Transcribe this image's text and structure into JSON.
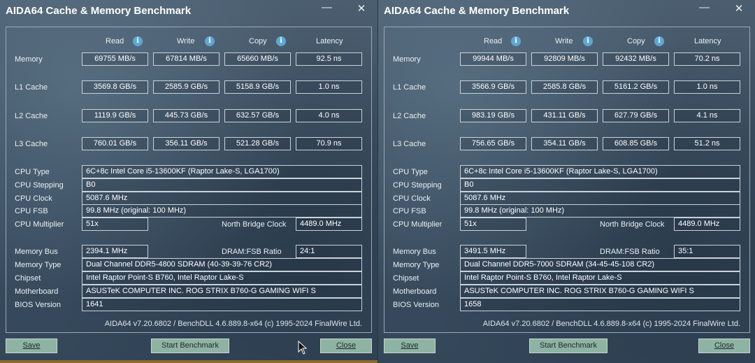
{
  "windows": [
    {
      "title": "AIDA64 Cache & Memory Benchmark",
      "headers": {
        "read": "Read",
        "write": "Write",
        "copy": "Copy",
        "latency": "Latency"
      },
      "rows": [
        {
          "label": "Memory",
          "read": "69755 MB/s",
          "write": "67814 MB/s",
          "copy": "65660 MB/s",
          "latency": "92.5 ns"
        },
        {
          "label": "L1 Cache",
          "read": "3569.8 GB/s",
          "write": "2585.9 GB/s",
          "copy": "5158.9 GB/s",
          "latency": "1.0 ns"
        },
        {
          "label": "L2 Cache",
          "read": "1119.9 GB/s",
          "write": "445.73 GB/s",
          "copy": "632.57 GB/s",
          "latency": "4.0 ns"
        },
        {
          "label": "L3 Cache",
          "read": "760.01 GB/s",
          "write": "356.11 GB/s",
          "copy": "521.28 GB/s",
          "latency": "70.9 ns"
        }
      ],
      "info": {
        "cpu_type_label": "CPU Type",
        "cpu_type": "6C+8c Intel Core i5-13600KF  (Raptor Lake-S, LGA1700)",
        "cpu_stepping_label": "CPU Stepping",
        "cpu_stepping": "B0",
        "cpu_clock_label": "CPU Clock",
        "cpu_clock": "5087.6 MHz",
        "cpu_fsb_label": "CPU FSB",
        "cpu_fsb": "99.8 MHz  (original: 100 MHz)",
        "cpu_multiplier_label": "CPU Multiplier",
        "cpu_multiplier": "51x",
        "north_bridge_label": "North Bridge Clock",
        "north_bridge": "4489.0 MHz",
        "memory_bus_label": "Memory Bus",
        "memory_bus": "2394.1 MHz",
        "dram_fsb_label": "DRAM:FSB Ratio",
        "dram_fsb": "24:1",
        "memory_type_label": "Memory Type",
        "memory_type": "Dual Channel DDR5-4800 SDRAM  (40-39-39-76 CR2)",
        "chipset_label": "Chipset",
        "chipset": "Intel Raptor Point-S B760, Intel Raptor Lake-S",
        "motherboard_label": "Motherboard",
        "motherboard": "ASUSTeK COMPUTER INC. ROG STRIX B760-G GAMING WIFI S",
        "bios_label": "BIOS Version",
        "bios": "1641"
      },
      "footer": "AIDA64 v7.20.6802 / BenchDLL 4.6.889.8-x64  (c) 1995-2024 FinalWire Ltd.",
      "buttons": {
        "save": "Save",
        "start": "Start Benchmark",
        "close": "Close"
      }
    },
    {
      "title": "AIDA64 Cache & Memory Benchmark",
      "headers": {
        "read": "Read",
        "write": "Write",
        "copy": "Copy",
        "latency": "Latency"
      },
      "rows": [
        {
          "label": "Memory",
          "read": "99944 MB/s",
          "write": "92809 MB/s",
          "copy": "92432 MB/s",
          "latency": "70.2 ns"
        },
        {
          "label": "L1 Cache",
          "read": "3566.9 GB/s",
          "write": "2585.8 GB/s",
          "copy": "5161.2 GB/s",
          "latency": "1.0 ns"
        },
        {
          "label": "L2 Cache",
          "read": "983.19 GB/s",
          "write": "431.11 GB/s",
          "copy": "627.79 GB/s",
          "latency": "4.1 ns"
        },
        {
          "label": "L3 Cache",
          "read": "756.65 GB/s",
          "write": "354.11 GB/s",
          "copy": "608.85 GB/s",
          "latency": "51.2 ns"
        }
      ],
      "info": {
        "cpu_type_label": "CPU Type",
        "cpu_type": "6C+8c Intel Core i5-13600KF  (Raptor Lake-S, LGA1700)",
        "cpu_stepping_label": "CPU Stepping",
        "cpu_stepping": "B0",
        "cpu_clock_label": "CPU Clock",
        "cpu_clock": "5087.6 MHz",
        "cpu_fsb_label": "CPU FSB",
        "cpu_fsb": "99.8 MHz  (original: 100 MHz)",
        "cpu_multiplier_label": "CPU Multiplier",
        "cpu_multiplier": "51x",
        "north_bridge_label": "North Bridge Clock",
        "north_bridge": "4489.0 MHz",
        "memory_bus_label": "Memory Bus",
        "memory_bus": "3491.5 MHz",
        "dram_fsb_label": "DRAM:FSB Ratio",
        "dram_fsb": "35:1",
        "memory_type_label": "Memory Type",
        "memory_type": "Dual Channel DDR5-7000 SDRAM  (34-45-45-108 CR2)",
        "chipset_label": "Chipset",
        "chipset": "Intel Raptor Point-S B760, Intel Raptor Lake-S",
        "motherboard_label": "Motherboard",
        "motherboard": "ASUSTeK COMPUTER INC. ROG STRIX B760-G GAMING WIFI S",
        "bios_label": "BIOS Version",
        "bios": "1658"
      },
      "footer": "AIDA64 v7.20.6802 / BenchDLL 4.6.889.8-x64  (c) 1995-2024 FinalWire Ltd.",
      "buttons": {
        "save": "Save",
        "start": "Start Benchmark",
        "close": "Close"
      }
    }
  ],
  "icons": {
    "info": "info-icon",
    "minimize": "minimize-icon",
    "close": "close-icon",
    "cursor": "mouse-pointer-icon"
  }
}
